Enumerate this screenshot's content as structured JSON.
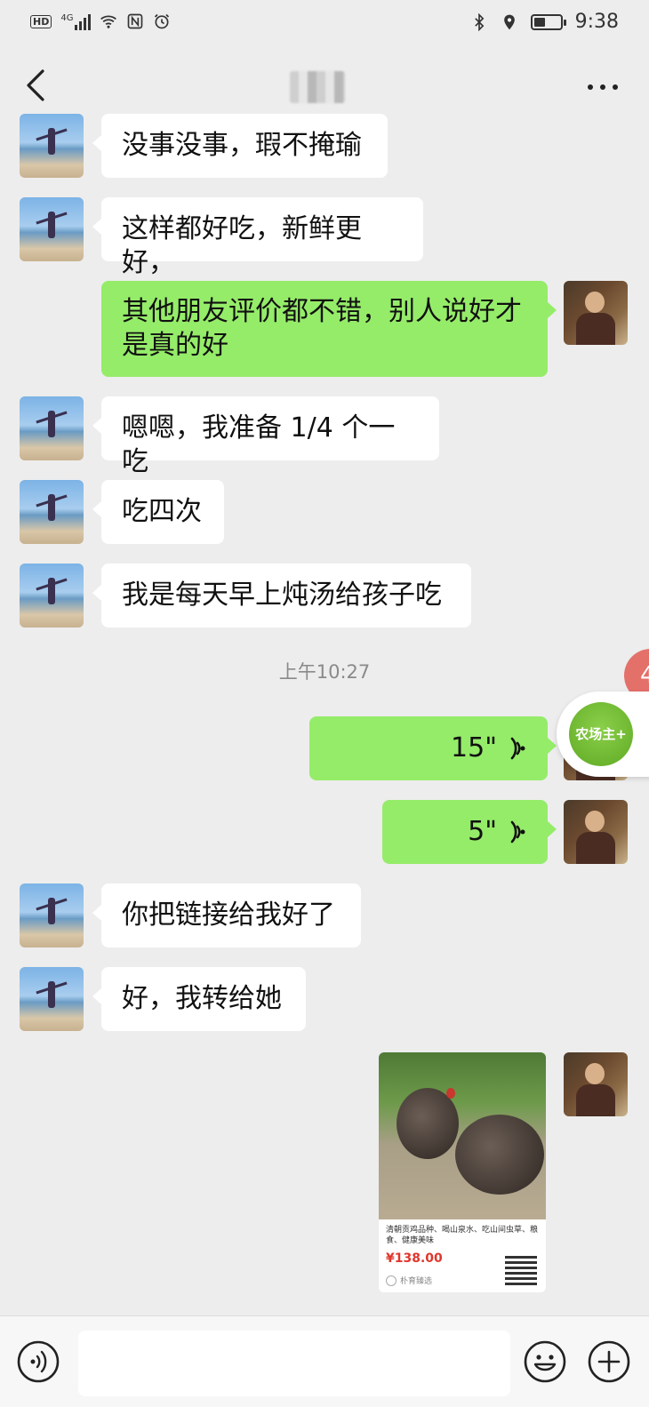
{
  "status_bar": {
    "network_left": "HD",
    "signal_label": "4G",
    "time": "9:38",
    "battery_level": 0.45
  },
  "header": {
    "contact_name_blurred": true
  },
  "messages": [
    {
      "side": "left",
      "text": "没事没事，瑕不掩瑜"
    },
    {
      "side": "left",
      "text": "这样都好吃，新鲜更好，"
    },
    {
      "side": "right",
      "text": "其他朋友评价都不错，别人说好才是真的好"
    },
    {
      "side": "left",
      "text": "嗯嗯，我准备 1/4 个一吃"
    },
    {
      "side": "left",
      "text": "吃四次"
    },
    {
      "side": "left",
      "text": "我是每天早上炖汤给孩子吃"
    },
    {
      "side": "right",
      "voice": "15\""
    },
    {
      "side": "right",
      "voice": "5\""
    },
    {
      "side": "left",
      "text": "你把链接给我好了"
    },
    {
      "side": "left",
      "text": "好，我转给她"
    }
  ],
  "timestamp": "上午10:27",
  "product_card": {
    "description": "清朝贡鸡品种、喝山泉水、吃山间虫草、粮食、健康美味",
    "price": "¥138.00",
    "shop": "朴育臻选"
  },
  "floating": {
    "badge_text": "4",
    "farm_label": "农场主+"
  },
  "input_bar": {
    "voice_icon": "voice-icon",
    "emoji_icon": "emoji-icon",
    "plus_icon": "plus-icon"
  }
}
